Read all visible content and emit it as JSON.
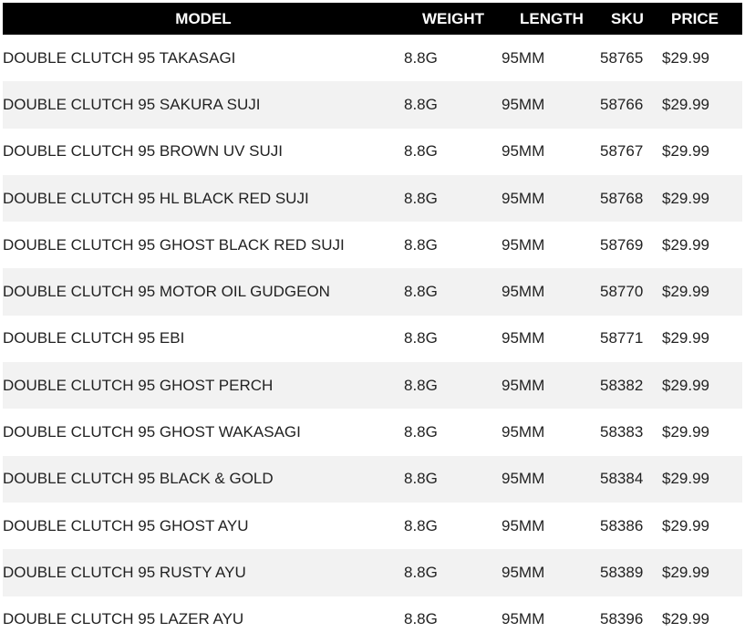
{
  "table": {
    "headers": {
      "model": "MODEL",
      "weight": "WEIGHT",
      "length": "LENGTH",
      "sku": "SKU",
      "price": "PRICE"
    },
    "rows": [
      {
        "model": "DOUBLE CLUTCH 95 TAKASAGI",
        "weight": "8.8G",
        "length": "95MM",
        "sku": "58765",
        "price": "$29.99"
      },
      {
        "model": "DOUBLE CLUTCH 95 SAKURA SUJI",
        "weight": "8.8G",
        "length": "95MM",
        "sku": "58766",
        "price": "$29.99"
      },
      {
        "model": "DOUBLE CLUTCH 95 BROWN UV SUJI",
        "weight": "8.8G",
        "length": "95MM",
        "sku": "58767",
        "price": "$29.99"
      },
      {
        "model": "DOUBLE CLUTCH 95 HL BLACK RED SUJI",
        "weight": "8.8G",
        "length": "95MM",
        "sku": "58768",
        "price": "$29.99"
      },
      {
        "model": "DOUBLE CLUTCH 95 GHOST BLACK RED SUJI",
        "weight": "8.8G",
        "length": "95MM",
        "sku": "58769",
        "price": "$29.99"
      },
      {
        "model": "DOUBLE CLUTCH 95 MOTOR OIL GUDGEON",
        "weight": "8.8G",
        "length": "95MM",
        "sku": "58770",
        "price": "$29.99"
      },
      {
        "model": "DOUBLE CLUTCH 95 EBI",
        "weight": "8.8G",
        "length": "95MM",
        "sku": "58771",
        "price": "$29.99"
      },
      {
        "model": "DOUBLE CLUTCH 95 GHOST PERCH",
        "weight": "8.8G",
        "length": "95MM",
        "sku": "58382",
        "price": "$29.99"
      },
      {
        "model": "DOUBLE CLUTCH 95 GHOST WAKASAGI",
        "weight": "8.8G",
        "length": "95MM",
        "sku": "58383",
        "price": "$29.99"
      },
      {
        "model": "DOUBLE CLUTCH 95 BLACK & GOLD",
        "weight": "8.8G",
        "length": "95MM",
        "sku": "58384",
        "price": "$29.99"
      },
      {
        "model": "DOUBLE CLUTCH 95 GHOST AYU",
        "weight": "8.8G",
        "length": "95MM",
        "sku": "58386",
        "price": "$29.99"
      },
      {
        "model": "DOUBLE CLUTCH 95 RUSTY AYU",
        "weight": "8.8G",
        "length": "95MM",
        "sku": "58389",
        "price": "$29.99"
      },
      {
        "model": "DOUBLE CLUTCH 95 LAZER AYU",
        "weight": "8.8G",
        "length": "95MM",
        "sku": "58396",
        "price": "$29.99"
      }
    ]
  },
  "colors": {
    "header_bg": "#000000",
    "header_text": "#ffffff",
    "row_alt_bg": "#f2f2f2",
    "body_text": "#222222"
  }
}
